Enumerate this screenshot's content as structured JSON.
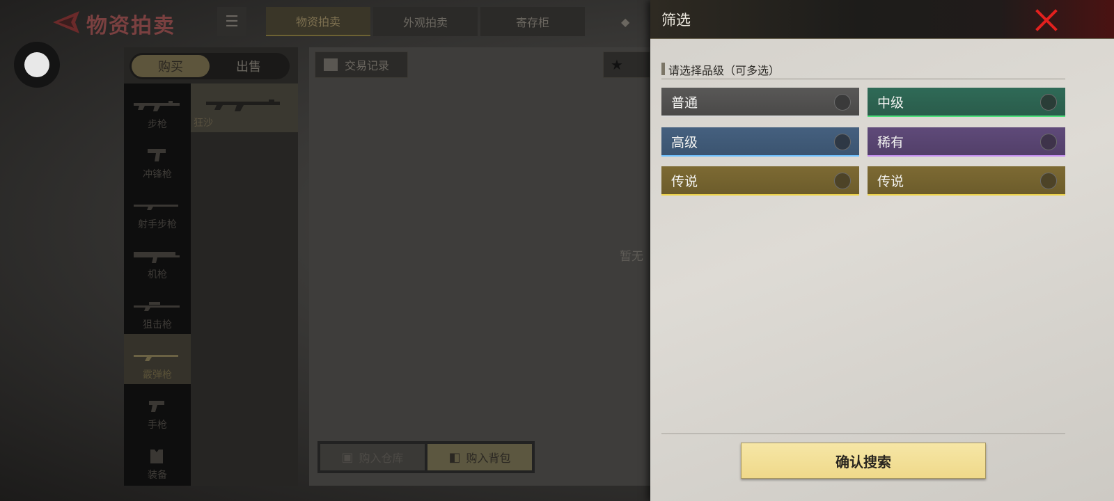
{
  "header": {
    "title": "物资拍卖",
    "tabs": [
      {
        "label": "物资拍卖",
        "active": true
      },
      {
        "label": "外观拍卖",
        "active": false
      },
      {
        "label": "寄存柜",
        "active": false
      }
    ]
  },
  "market": {
    "buy_label": "购买",
    "sell_label": "出售",
    "categories": [
      {
        "label": "步枪",
        "icon": "rifle-icon"
      },
      {
        "label": "冲锋枪",
        "icon": "smg-icon"
      },
      {
        "label": "射手步枪",
        "icon": "marksman-rifle-icon"
      },
      {
        "label": "机枪",
        "icon": "machine-gun-icon"
      },
      {
        "label": "狙击枪",
        "icon": "sniper-icon"
      },
      {
        "label": "霰弹枪",
        "icon": "shotgun-icon",
        "active": true
      },
      {
        "label": "手枪",
        "icon": "pistol-icon"
      },
      {
        "label": "装备",
        "icon": "vest-icon"
      }
    ],
    "item_name": "狂沙",
    "trade_record_label": "交易记录",
    "empty_text": "暂无",
    "buy_to_warehouse_label": "购入仓库",
    "buy_to_backpack_label": "购入背包"
  },
  "filter": {
    "title": "筛选",
    "section_label": "请选择品级（可多选）",
    "grades": [
      {
        "label": "普通",
        "selected": false
      },
      {
        "label": "中级",
        "selected": false
      },
      {
        "label": "高级",
        "selected": false
      },
      {
        "label": "稀有",
        "selected": false
      },
      {
        "label": "传说",
        "selected": false
      },
      {
        "label": "传说",
        "selected": false
      }
    ],
    "confirm_label": "确认搜索"
  },
  "colors": {
    "common": "#595857",
    "mid": "#2f6a57",
    "high": "#45607f",
    "rare": "#5f4a79",
    "legend": "#7d6a33",
    "confirm": "#f2dd92",
    "close": "#e3201e"
  }
}
